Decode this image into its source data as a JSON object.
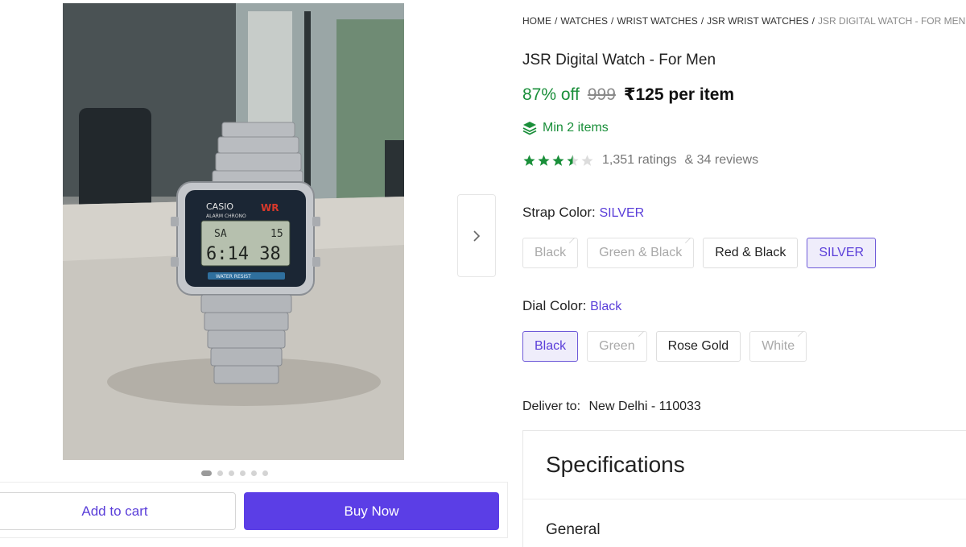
{
  "gallery": {
    "image_alt": "Silver digital wrist watch on a table",
    "watch_face": {
      "brand": "CASIO",
      "badge": "WR",
      "subtitle": "ALARM CHRONO",
      "row1_left": "SA",
      "row1_right": "15",
      "time": "6:14 38",
      "bottom_text": "WATER RESIST"
    },
    "dot_count": 6,
    "active_dot": 1
  },
  "actions": {
    "add_to_cart": "Add to cart",
    "buy_now": "Buy Now"
  },
  "breadcrumb": {
    "items": [
      "HOME",
      "WATCHES",
      "WRIST WATCHES",
      "JSR WRIST WATCHES"
    ],
    "separator": "/",
    "current": "JSR DIGITAL WATCH - FOR MEN"
  },
  "product": {
    "title": "JSR Digital Watch  - For Men",
    "discount": "87% off",
    "mrp": "999",
    "price": "₹125 per item",
    "min_items": "Min 2 items",
    "rating_value": 3.5,
    "ratings_text": "1,351 ratings",
    "reviews_text": "& 34 reviews"
  },
  "strap_color": {
    "label": "Strap Color:",
    "selected": "SILVER",
    "options": [
      {
        "label": "Black",
        "state": "disabled"
      },
      {
        "label": "Green & Black",
        "state": "disabled"
      },
      {
        "label": "Red & Black",
        "state": "enabled"
      },
      {
        "label": "SILVER",
        "state": "selected"
      }
    ]
  },
  "dial_color": {
    "label": "Dial Color:",
    "selected": "Black",
    "options": [
      {
        "label": "Black",
        "state": "selected"
      },
      {
        "label": "Green",
        "state": "disabled"
      },
      {
        "label": "Rose Gold",
        "state": "enabled"
      },
      {
        "label": "White",
        "state": "disabled"
      }
    ]
  },
  "delivery": {
    "label": "Deliver to:",
    "location": "New Delhi - 110033"
  },
  "specifications": {
    "title": "Specifications",
    "sections": [
      "General"
    ]
  },
  "colors": {
    "accent": "#5b3ee6",
    "discount_green": "#1a8f3a",
    "star_green": "#1a8f3a"
  },
  "icons": {
    "carousel_next": "chevron-right-icon",
    "min_items": "layers-icon",
    "rating": "star-icon"
  }
}
